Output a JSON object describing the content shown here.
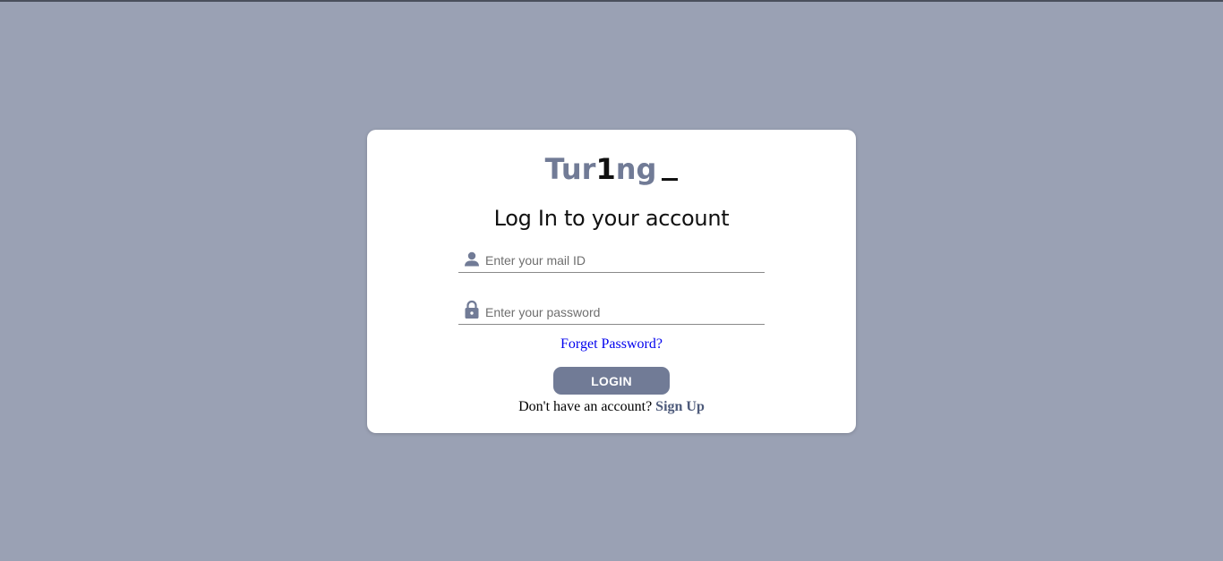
{
  "logo": {
    "part1": "Tur",
    "part2": "1",
    "part3": "ng"
  },
  "page_title": "Log In to your account",
  "email_field": {
    "placeholder": "Enter your mail ID",
    "icon": "person-icon"
  },
  "password_field": {
    "placeholder": "Enter your password",
    "icon": "lock-icon"
  },
  "forgot_link": "Forget Password?",
  "login_button": "LOGIN",
  "signup": {
    "prompt": "Don't have an account?",
    "link": "Sign Up"
  },
  "colors": {
    "background": "#9aa1b4",
    "accent": "#717b96",
    "link": "#0000ee",
    "signup_link": "#4d5a7a"
  }
}
